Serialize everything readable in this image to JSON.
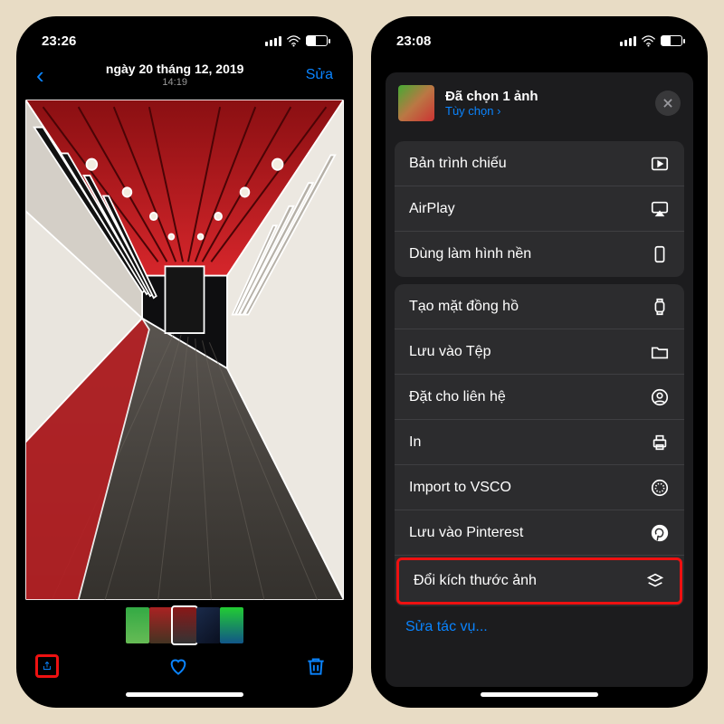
{
  "left": {
    "status_time": "23:26",
    "nav_date": "ngày 20 tháng 12, 2019",
    "nav_time": "14:19",
    "edit_label": "Sửa"
  },
  "right": {
    "status_time": "23:08",
    "sheet_title": "Đã chọn 1 ảnh",
    "sheet_options": "Tùy chọn",
    "group1": [
      {
        "label": "Bản trình chiếu",
        "icon": "play-rect"
      },
      {
        "label": "AirPlay",
        "icon": "airplay"
      },
      {
        "label": "Dùng làm hình nền",
        "icon": "phone"
      }
    ],
    "group2": [
      {
        "label": "Tạo mặt đồng hồ",
        "icon": "watch"
      },
      {
        "label": "Lưu vào Tệp",
        "icon": "folder"
      },
      {
        "label": "Đặt cho liên hệ",
        "icon": "contact"
      },
      {
        "label": "In",
        "icon": "print"
      },
      {
        "label": "Import to VSCO",
        "icon": "vsco"
      },
      {
        "label": "Lưu vào Pinterest",
        "icon": "pinterest"
      },
      {
        "label": "Đổi kích thước ảnh",
        "icon": "layers",
        "highlight": true
      }
    ],
    "edit_actions": "Sửa tác vụ..."
  }
}
